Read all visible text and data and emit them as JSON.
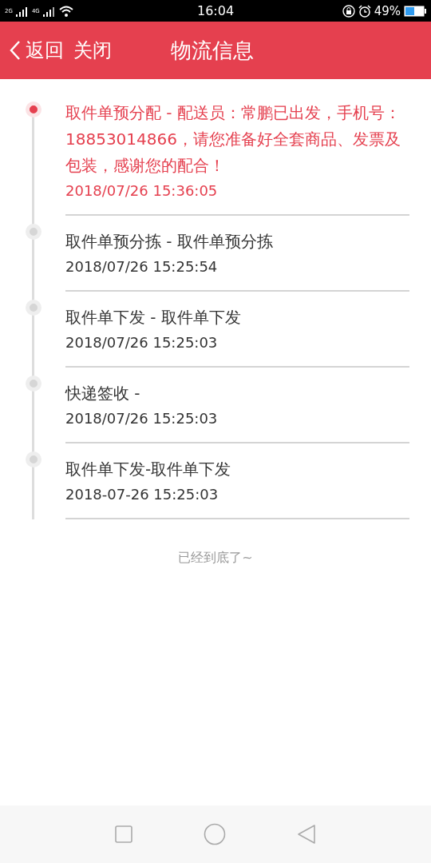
{
  "status_bar": {
    "network_1": "2G",
    "network_2": "4G",
    "time": "16:04",
    "battery": "49%"
  },
  "header": {
    "back": "返回",
    "close": "关闭",
    "title": "物流信息"
  },
  "events": [
    {
      "text": "取件单预分配 - 配送员：常鹏已出发，手机号：18853014866，请您准备好全套商品、发票及包装，感谢您的配合！",
      "time": "2018/07/26 15:36:05",
      "current": true
    },
    {
      "text": "取件单预分拣 - 取件单预分拣",
      "time": "2018/07/26 15:25:54",
      "current": false
    },
    {
      "text": "取件单下发 - 取件单下发",
      "time": "2018/07/26 15:25:03",
      "current": false
    },
    {
      "text": "快递签收 -",
      "time": "2018/07/26 15:25:03",
      "current": false
    },
    {
      "text": "取件单下发-取件单下发",
      "time": "2018-07-26 15:25:03",
      "current": false
    }
  ],
  "end_note": "已经到底了~"
}
